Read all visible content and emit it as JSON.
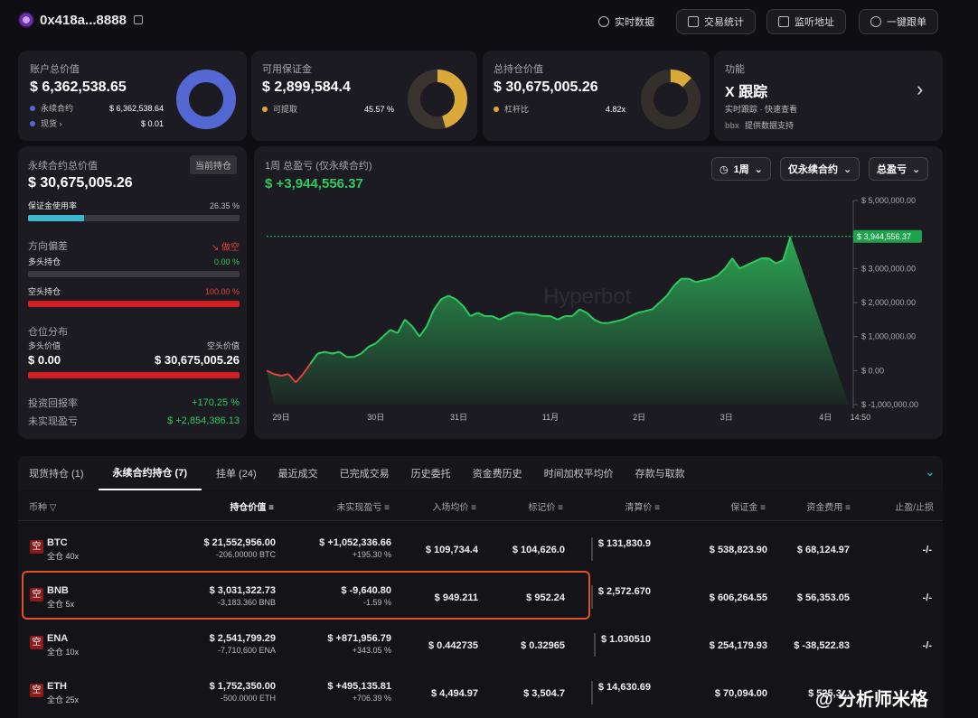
{
  "header": {
    "address": "0x418a...8888",
    "buttons": [
      "实时数据",
      "交易统计",
      "监听地址",
      "一键跟单"
    ]
  },
  "cards": {
    "account": {
      "title": "账户总价值",
      "value": "$ 6,362,538.65",
      "perp_label": "永续合约",
      "perp_value": "$ 6,362,538.64",
      "spot_label": "现货",
      "spot_arrow": "›",
      "spot_value": "$ 0.01"
    },
    "margin": {
      "title": "可用保证金",
      "value": "$ 2,899,584.4",
      "sub_label": "可提取",
      "sub_value": "45.57 %"
    },
    "holding": {
      "title": "总持仓价值",
      "value": "$ 30,675,005.26",
      "sub_label": "杠杆比",
      "sub_value": "4.82x"
    },
    "feature": {
      "title": "功能",
      "value": "X 跟踪",
      "desc": "实时跟踪 · 快速查看",
      "brand": "提供数据支持",
      "logo_text": "bbx"
    }
  },
  "left_panel": {
    "title": "永续合约总价值",
    "tag": "当前持仓",
    "value": "$ 30,675,005.26",
    "margin_usage_label": "保证金使用率",
    "margin_usage_value": "26.35 %",
    "margin_usage_pct": 26.35,
    "bias_label": "方向偏差",
    "bias_value": "做空",
    "long_label": "多头持仓",
    "long_value": "0.00 %",
    "long_pct": 0,
    "short_label": "空头持仓",
    "short_value": "100.00 %",
    "short_pct": 100,
    "dist_label": "仓位分布",
    "long_val_label": "多头价值",
    "short_val_label": "空头价值",
    "long_val": "$ 0.00",
    "short_val": "$ 30,675,005.26",
    "roi_label": "投资回报率",
    "roi_value": "+170.25 %",
    "upnl_label": "未实现盈亏",
    "upnl_value": "$ +2,854,386.13"
  },
  "chart_panel": {
    "title": "1周 总盈亏 (仅永续合约)",
    "value": "$ +3,944,556.37",
    "sel_period": "1周",
    "sel_scope": "仅永续合约",
    "sel_metric": "总盈亏",
    "watermark": "Hyperbot",
    "current_label": "$ 3,944,556.37"
  },
  "chart_data": {
    "type": "area",
    "x_tick_labels": [
      "29日",
      "30日",
      "31日",
      "11月",
      "2日",
      "3日",
      "4日",
      "14:50"
    ],
    "y_tick_labels": [
      "$ 5,000,000.00",
      "$ 4,000,000.00",
      "$ 3,000,000.00",
      "$ 2,000,000.00",
      "$ 1,000,000.00",
      "$ 0.00",
      "$ -1,000,000.00"
    ],
    "ylim": [
      -1000000,
      5000000
    ],
    "x_days": [
      0,
      0.25,
      0.5,
      0.75,
      1,
      1.25,
      1.5,
      1.75,
      2,
      2.25,
      2.5,
      2.75,
      3,
      3.25,
      3.5,
      3.75,
      4,
      4.25,
      4.5,
      4.75,
      5,
      5.25,
      5.5,
      5.75,
      6,
      6.25,
      6.5,
      6.75,
      7,
      7.25,
      7.5,
      7.75,
      8,
      8.25,
      8.5,
      8.75,
      9,
      9.25,
      9.5,
      9.75,
      10,
      10.25,
      10.5,
      10.75,
      11,
      11.25,
      11.5,
      11.75,
      12,
      12.25,
      12.5,
      12.75,
      13,
      13.25,
      13.5,
      13.75,
      14,
      14.25,
      14.5,
      14.75,
      15,
      15.25,
      15.5,
      15.75,
      16,
      16.25,
      16.5,
      16.75,
      17,
      17.25,
      17.5,
      17.75,
      18,
      18.25,
      18.5,
      18.75,
      19,
      19.25,
      19.5,
      19.75,
      20
    ],
    "values": [
      0,
      -100000,
      -150000,
      -100000,
      -350000,
      -100000,
      200000,
      500000,
      550000,
      500000,
      550000,
      400000,
      400000,
      500000,
      700000,
      800000,
      1000000,
      1200000,
      1100000,
      1500000,
      1300000,
      1000000,
      1300000,
      1800000,
      2100000,
      2200000,
      2100000,
      1900000,
      1600000,
      1700000,
      1600000,
      1600000,
      1500000,
      1600000,
      1700000,
      1700000,
      1650000,
      1650000,
      1600000,
      1600000,
      1500000,
      1600000,
      1600000,
      1800000,
      1700000,
      1500000,
      1400000,
      1400000,
      1450000,
      1500000,
      1600000,
      1700000,
      1750000,
      1800000,
      2000000,
      2200000,
      2500000,
      2700000,
      2700000,
      2600000,
      2650000,
      2700000,
      2800000,
      3000000,
      3300000,
      3000000,
      3100000,
      3200000,
      3300000,
      3300000,
      3150000,
      3250000,
      3944556
    ]
  },
  "tabs": [
    "现货持仓 (1)",
    "永续合约持仓 (7)",
    "挂单 (24)",
    "最近成交",
    "已完成交易",
    "历史委托",
    "资金费历史",
    "时间加权平均价",
    "存款与取款"
  ],
  "table": {
    "headers": [
      "币种",
      "持仓价值",
      "未实现盈亏",
      "入场均价",
      "标记价",
      "清算价",
      "保证金",
      "资金费用",
      "止盈/止损"
    ],
    "rows": [
      {
        "badge": "空",
        "coin": "BTC",
        "mode": "全仓 40x",
        "value": "$ 21,552,956.00",
        "size": "-206.00000 BTC",
        "upnl": "$ +1,052,336.66",
        "upnl_pct": "+195.30 %",
        "entry": "$ 109,734.4",
        "mark": "$ 104,626.0",
        "liq": "$ 131,830.9",
        "margin": "$ 538,823.90",
        "funding": "$ 68,124.97",
        "tpsl": "-/-",
        "pos": true,
        "fpos": true
      },
      {
        "badge": "空",
        "coin": "BNB",
        "mode": "全仓 5x",
        "value": "$ 3,031,322.73",
        "size": "-3,183.360 BNB",
        "upnl": "$ -9,640.80",
        "upnl_pct": "-1.59 %",
        "entry": "$ 949.211",
        "mark": "$ 952.24",
        "liq": "$ 2,572.670",
        "margin": "$ 606,264.55",
        "funding": "$ 56,353.05",
        "tpsl": "-/-",
        "pos": false,
        "fpos": true
      },
      {
        "badge": "空",
        "coin": "ENA",
        "mode": "全仓 10x",
        "value": "$ 2,541,799.29",
        "size": "-7,710,600 ENA",
        "upnl": "$ +871,956.79",
        "upnl_pct": "+343.05 %",
        "entry": "$ 0.442735",
        "mark": "$ 0.32965",
        "liq": "$ 1.030510",
        "margin": "$ 254,179.93",
        "funding": "$ -38,522.83",
        "tpsl": "-/-",
        "pos": true,
        "fpos": false
      },
      {
        "badge": "空",
        "coin": "ETH",
        "mode": "全仓 25x",
        "value": "$ 1,752,350.00",
        "size": "-500.0000 ETH",
        "upnl": "$ +495,135.81",
        "upnl_pct": "+706.39 %",
        "entry": "$ 4,494.97",
        "mark": "$ 3,504.7",
        "liq": "$ 14,630.69",
        "margin": "$ 70,094.00",
        "funding": "$ 525,3...",
        "tpsl": "",
        "pos": true,
        "fpos": true
      }
    ]
  },
  "watermark_footer": "@ 分析师米格",
  "colors": {
    "green": "#2fc95f",
    "red": "#e2413d",
    "highlight": "#e0502a",
    "donut_blue": "#5468d4",
    "donut_gold": "#d9a93a"
  }
}
